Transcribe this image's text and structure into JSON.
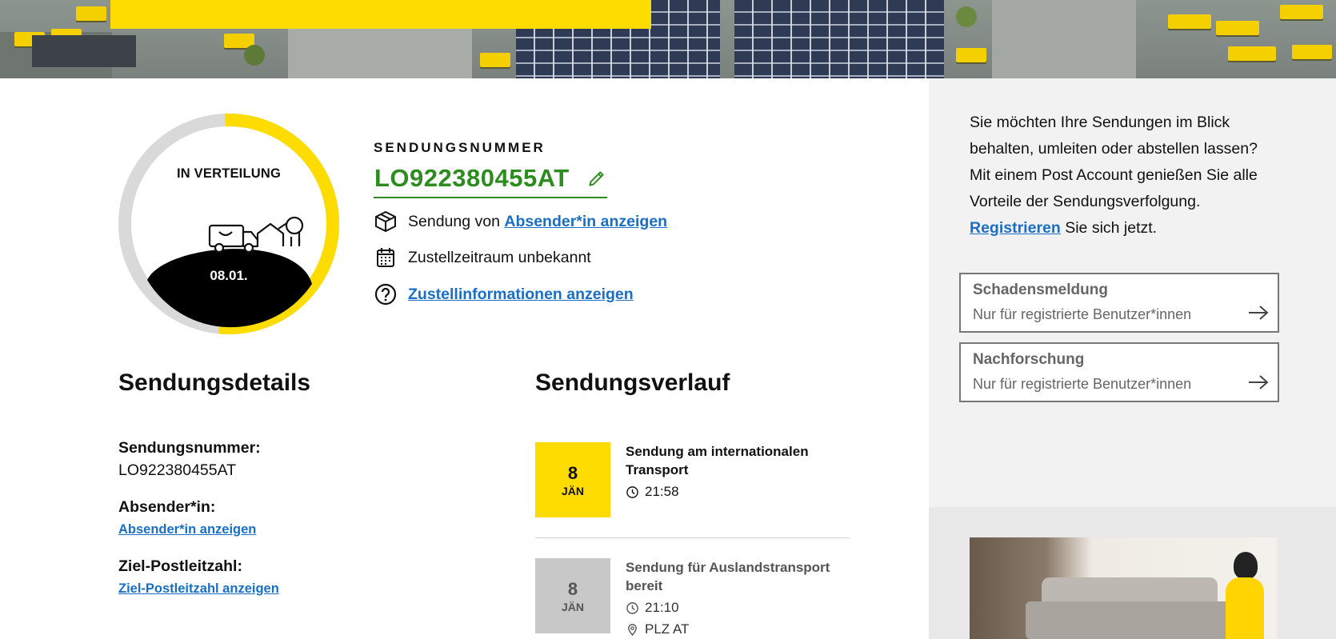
{
  "status": {
    "label": "IN VERTEILUNG",
    "date": "08.01.",
    "progress_fraction": 0.52,
    "colors": {
      "progress": "#ffdc00",
      "track": "#d9d9d9",
      "hill": "#000000"
    }
  },
  "tracking": {
    "caption": "SENDUNGSNUMMER",
    "number": "LO922380455AT",
    "sender_prefix": "Sendung von",
    "sender_link": "Absender*in anzeigen",
    "delivery_window": "Zustellzeitraum unbekannt",
    "delivery_info_link": "Zustellinformationen anzeigen"
  },
  "details": {
    "heading": "Sendungsdetails",
    "number_label": "Sendungsnummer:",
    "number_value": "LO922380455AT",
    "sender_label": "Absender*in:",
    "sender_link": "Absender*in anzeigen",
    "zip_label": "Ziel-Postleitzahl:",
    "zip_link": "Ziel-Postleitzahl anzeigen"
  },
  "history": {
    "heading": "Sendungsverlauf",
    "events": [
      {
        "day": "8",
        "month": "JÄN",
        "text": "Sendung am internationalen Transport",
        "time": "21:58",
        "location": ""
      },
      {
        "day": "8",
        "month": "JÄN",
        "text": "Sendung für Auslandstransport bereit",
        "time": "21:10",
        "location": "PLZ AT"
      }
    ]
  },
  "aside": {
    "intro": "Sie möchten Ihre Sendungen im Blick behalten, umleiten oder abstellen lassen? Mit einem Post Account genießen Sie alle Vorteile der Sendungsverfolgung.",
    "register_link": "Registrieren",
    "register_suffix": "Sie sich jetzt.",
    "cards": [
      {
        "title": "Schadensmeldung",
        "subtitle": "Nur für registrierte Benutzer*innen"
      },
      {
        "title": "Nachforschung",
        "subtitle": "Nur für registrierte Benutzer*innen"
      }
    ]
  },
  "colors": {
    "brand_yellow": "#ffdc00",
    "tracking_green": "#2e8b1f",
    "link_blue": "#1a6fc4",
    "aside_bg": "#f2f2f2",
    "event_active": "#ffdc00",
    "event_past": "#c8c8c8"
  }
}
